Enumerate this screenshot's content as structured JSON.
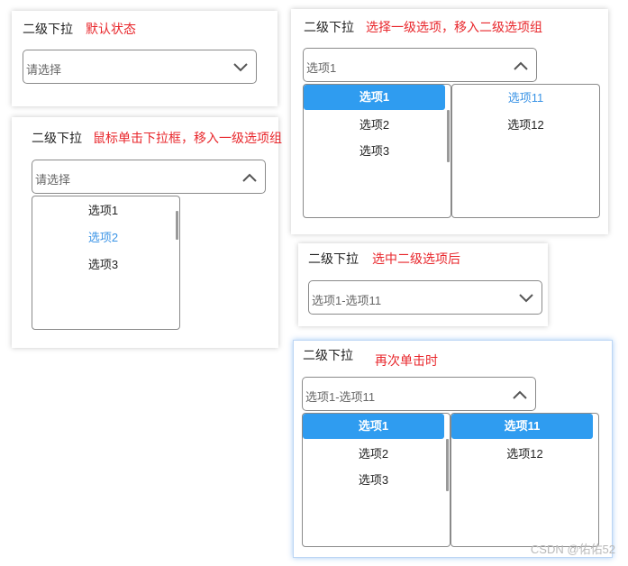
{
  "card1": {
    "title": "二级下拉",
    "note": "默认状态",
    "select_value": "请选择",
    "chevron": "chevron-down-icon"
  },
  "card2": {
    "title": "二级下拉",
    "note": "鼠标单击下拉框，移入一级选项组",
    "select_value": "请选择",
    "chevron": "chevron-up-icon",
    "options": [
      "选项1",
      "选项2",
      "选项3"
    ],
    "hover_option": "选项2"
  },
  "card3": {
    "title": "二级下拉",
    "note": "选择一级选项，移入二级选项组",
    "select_value": "选项1",
    "chevron": "chevron-up-icon",
    "level1": [
      "选项1",
      "选项2",
      "选项3"
    ],
    "level1_selected": "选项1",
    "level2": [
      "选项11",
      "选项12"
    ],
    "level2_hover": "选项11"
  },
  "card4": {
    "title": "二级下拉",
    "note": "选中二级选项后",
    "select_value": "选项1-选项11",
    "chevron": "chevron-down-icon"
  },
  "card5": {
    "title": "二级下拉",
    "note": "再次单击时",
    "select_value": "选项1-选项11",
    "chevron": "chevron-up-icon",
    "level1": [
      "选项1",
      "选项2",
      "选项3"
    ],
    "level1_selected": "选项1",
    "level2": [
      "选项11",
      "选项12"
    ],
    "level2_selected": "选项11"
  },
  "colors": {
    "accent": "#2f9cf0",
    "hover_text": "#3b94e6",
    "note_text": "#e8262b"
  },
  "watermark": "CSDN @佑佑52"
}
